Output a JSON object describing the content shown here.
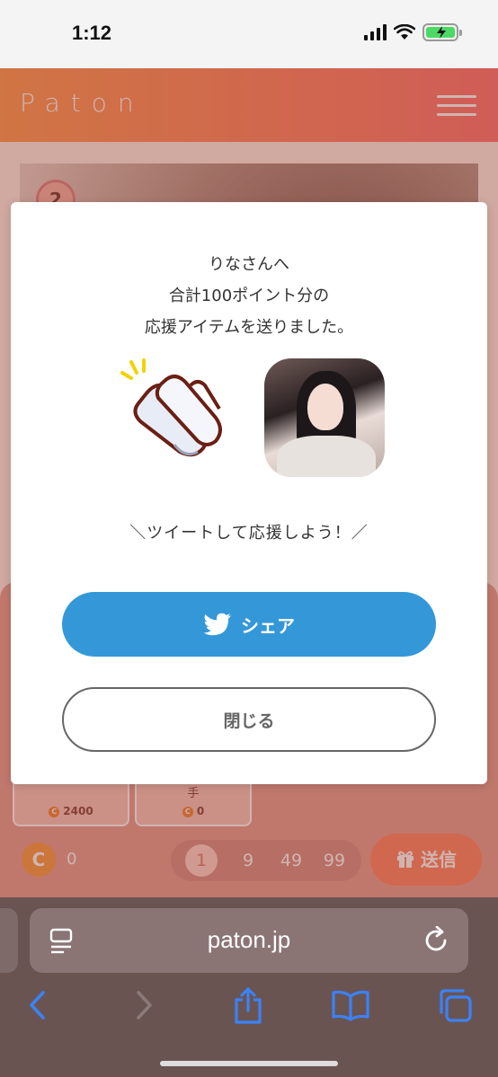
{
  "status_bar": {
    "time": "1:12"
  },
  "app_header": {
    "logo": "Paton"
  },
  "background": {
    "rank_badge": "2",
    "items": [
      {
        "name": "",
        "points": "2400"
      },
      {
        "name": "手",
        "points": "0"
      }
    ],
    "coin_balance": "0",
    "quantity_options": [
      "1",
      "9",
      "49",
      "99"
    ],
    "send_label": "送信"
  },
  "modal": {
    "message_lines": [
      "りなさんへ",
      "合計100ポイント分の",
      "応援アイテムを送りました。"
    ],
    "tweet_prompt": "＼ツイートして応援しよう！／",
    "share_label": "シェア",
    "close_label": "閉じる"
  },
  "browser": {
    "url": "paton.jp"
  },
  "colors": {
    "accent_orange": "#ff8a68",
    "twitter_blue": "#3498d8"
  }
}
